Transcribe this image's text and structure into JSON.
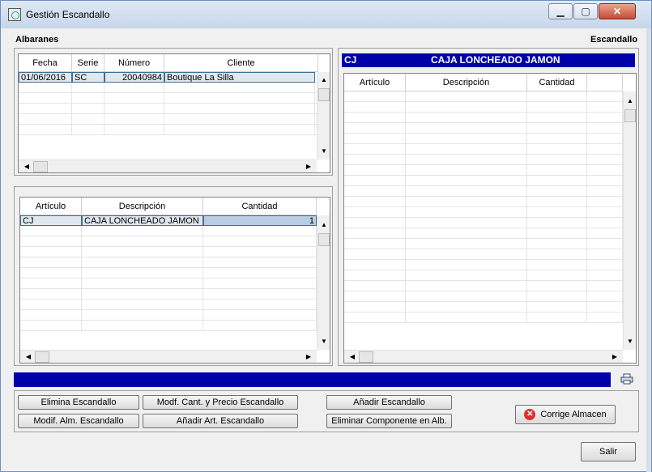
{
  "window": {
    "title": "Gestión Escandallo",
    "min_label": "▁",
    "max_label": "▢",
    "close_label": "✕"
  },
  "labels": {
    "albaranes": "Albaranes",
    "escandallo": "Escandallo"
  },
  "albaranes_grid": {
    "columns": [
      "Fecha",
      "Serie",
      "Número",
      "Cliente"
    ],
    "rows": [
      {
        "fecha": "01/06/2016",
        "serie": "SC",
        "numero": "20040984",
        "cliente": "Boutique La Silla"
      }
    ]
  },
  "lineas_grid": {
    "columns": [
      "Artículo",
      "Descripción",
      "Cantidad"
    ],
    "rows": [
      {
        "articulo": "CJ",
        "descripcion": "CAJA LONCHEADO JAMON",
        "cantidad": "1"
      }
    ]
  },
  "escandallo_header": {
    "code": "CJ",
    "name": "CAJA LONCHEADO JAMON"
  },
  "escandallo_grid": {
    "columns": [
      "Artículo",
      "Descripción",
      "Cantidad",
      ""
    ],
    "rows": []
  },
  "buttons": {
    "elimina_escandallo": "Elimina Escandallo",
    "modif_alm": "Modif. Alm. Escandallo",
    "modif_cant": "Modf. Cant. y Precio Escandallo",
    "anadir_art": "Añadir Art. Escandallo",
    "anadir_escandallo": "Añadir Escandallo",
    "eliminar_componente": "Eliminar Componente en Alb.",
    "corrige_almacen": "Corrige Almacen",
    "salir": "Salir"
  },
  "scroll_glyphs": {
    "up": "▲",
    "down": "▼",
    "left": "◀",
    "right": "▶"
  },
  "icons": {
    "close_circle": "✕"
  },
  "colors": {
    "header_blue": "#0000a8",
    "close_red": "#d9312b"
  }
}
